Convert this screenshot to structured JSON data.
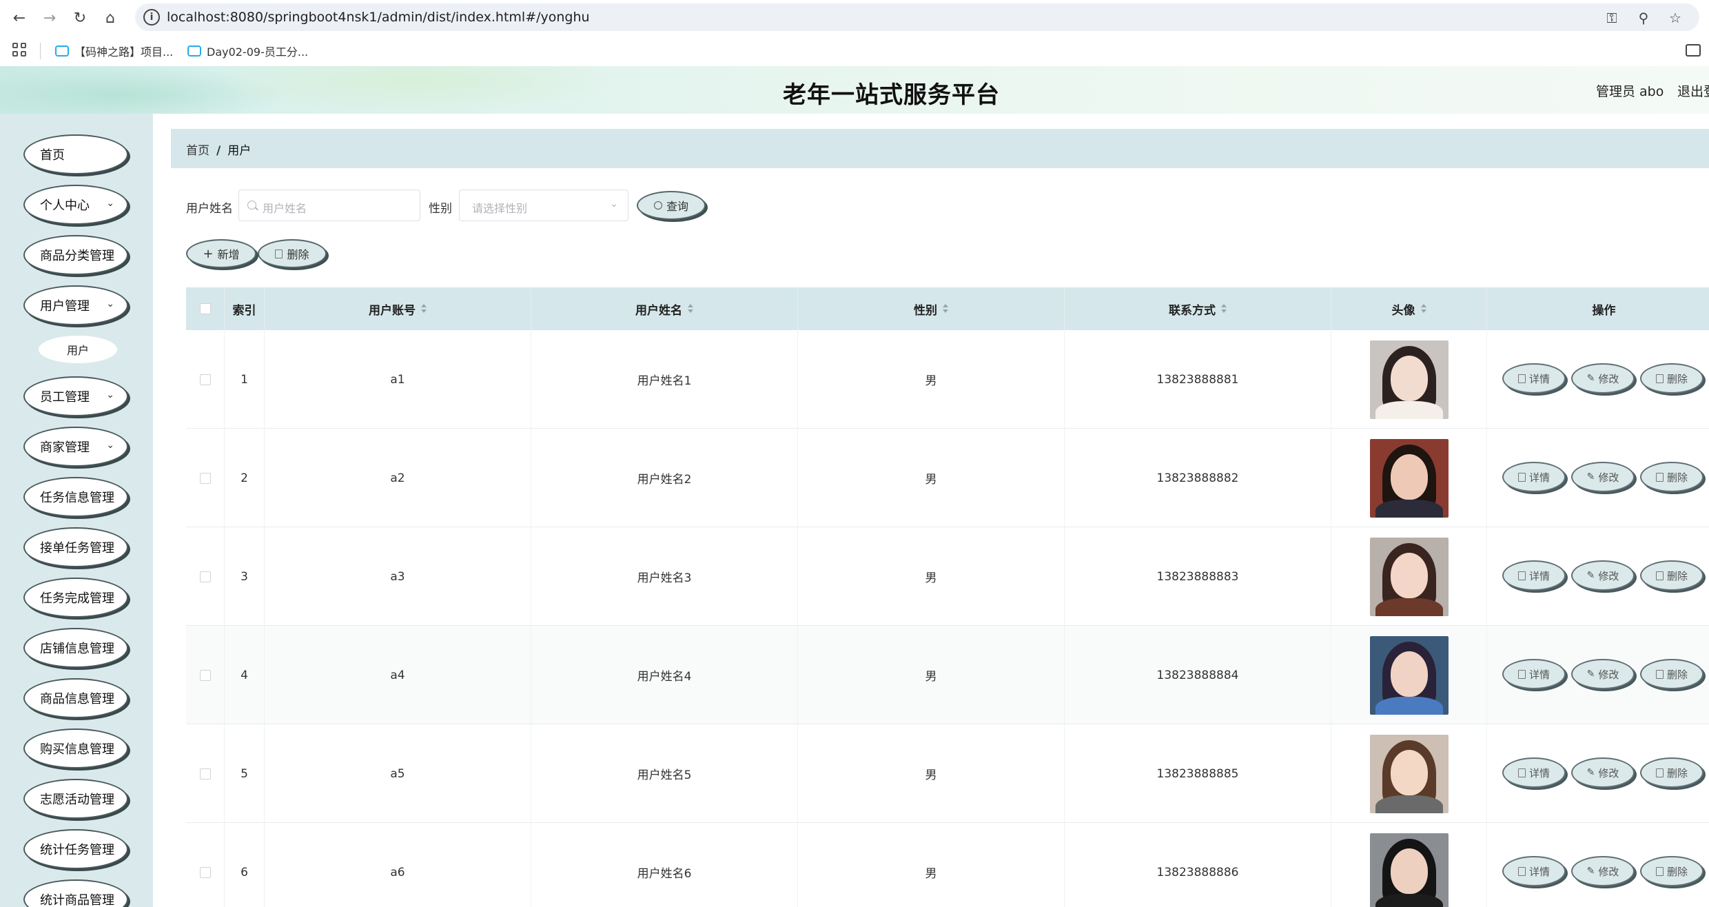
{
  "browser": {
    "url": "localhost:8080/springboot4nsk1/admin/dist/index.html#/yonghu",
    "bookmarks": [
      "【码神之路】项目...",
      "Day02-09-员工分..."
    ]
  },
  "header": {
    "title": "老年一站式服务平台",
    "admin": "管理员 abo",
    "logout": "退出登"
  },
  "sidebar": {
    "items": [
      {
        "label": "首页"
      },
      {
        "label": "个人中心"
      },
      {
        "label": "商品分类管理"
      },
      {
        "label": "用户管理"
      },
      {
        "label": "员工管理"
      },
      {
        "label": "商家管理"
      },
      {
        "label": "任务信息管理"
      },
      {
        "label": "接单任务管理"
      },
      {
        "label": "任务完成管理"
      },
      {
        "label": "店铺信息管理"
      },
      {
        "label": "商品信息管理"
      },
      {
        "label": "购买信息管理"
      },
      {
        "label": "志愿活动管理"
      },
      {
        "label": "统计任务管理"
      },
      {
        "label": "统计商品管理"
      }
    ],
    "submenu": {
      "label": "用户"
    }
  },
  "breadcrumb": {
    "home": "首页",
    "sep": "/",
    "current": "用户"
  },
  "search": {
    "name_label": "用户姓名",
    "name_placeholder": "用户姓名",
    "gender_label": "性别",
    "gender_placeholder": "请选择性别",
    "query_button": "查询"
  },
  "actions": {
    "add": "新增",
    "delete": "删除"
  },
  "table": {
    "headers": {
      "index": "索引",
      "account": "用户账号",
      "name": "用户姓名",
      "gender": "性别",
      "phone": "联系方式",
      "avatar": "头像",
      "ops": "操作"
    },
    "row_actions": {
      "detail": "详情",
      "edit": "修改",
      "delete": "删除"
    },
    "rows": [
      {
        "index": "1",
        "account": "a1",
        "name": "用户姓名1",
        "gender": "男",
        "phone": "13823888881"
      },
      {
        "index": "2",
        "account": "a2",
        "name": "用户姓名2",
        "gender": "男",
        "phone": "13823888882"
      },
      {
        "index": "3",
        "account": "a3",
        "name": "用户姓名3",
        "gender": "男",
        "phone": "13823888883"
      },
      {
        "index": "4",
        "account": "a4",
        "name": "用户姓名4",
        "gender": "男",
        "phone": "13823888884"
      },
      {
        "index": "5",
        "account": "a5",
        "name": "用户姓名5",
        "gender": "男",
        "phone": "13823888885"
      },
      {
        "index": "6",
        "account": "a6",
        "name": "用户姓名6",
        "gender": "男",
        "phone": "13823888886"
      }
    ]
  },
  "colors": {
    "sidebar_bg": "#daeaec",
    "table_header_bg": "#d5e7ea",
    "button_bg": "#dbe9ea"
  }
}
